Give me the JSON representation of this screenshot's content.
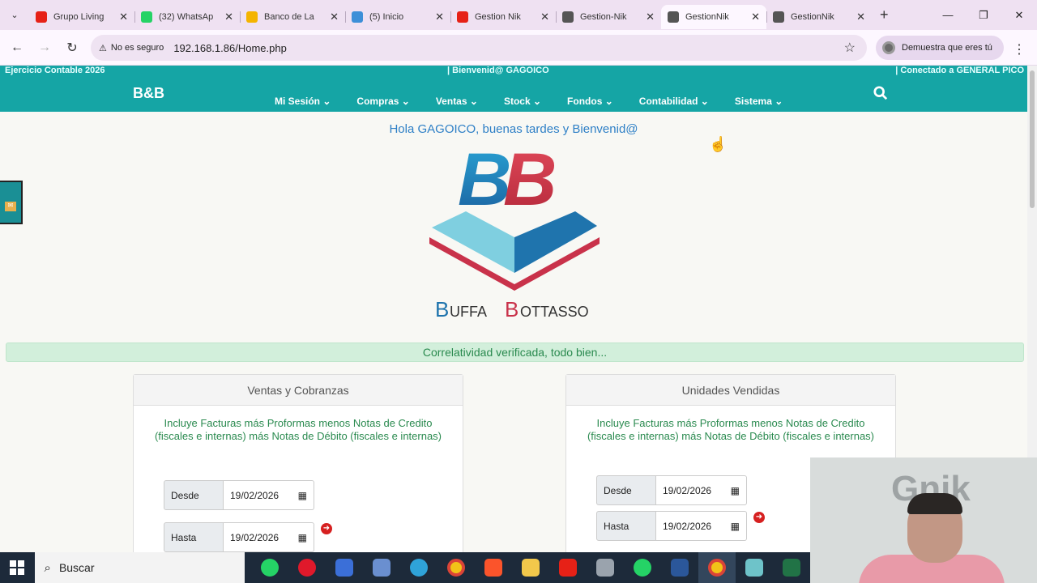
{
  "tabs": [
    {
      "label": "Grupo Living",
      "icon": "youtube-icon",
      "color": "#e62117"
    },
    {
      "label": "(32) WhatsAp",
      "icon": "whatsapp-icon",
      "color": "#25d366"
    },
    {
      "label": "Banco de La",
      "icon": "bank-icon",
      "color": "#f4b400"
    },
    {
      "label": "(5) Inicio",
      "icon": "cloud-icon",
      "color": "#3d8fd8"
    },
    {
      "label": "Gestion Nik",
      "icon": "youtube-icon",
      "color": "#e62117"
    },
    {
      "label": "Gestion-Nik",
      "icon": "network-icon",
      "color": "#555555"
    },
    {
      "label": "GestionNik",
      "icon": "globe-icon",
      "color": "#555555",
      "active": true
    },
    {
      "label": "GestionNik",
      "icon": "globe-icon",
      "color": "#555555"
    }
  ],
  "address": {
    "security": "No es seguro",
    "url": "192.168.1.86/Home.php"
  },
  "profile": {
    "label": "Demuestra que eres tú"
  },
  "site": {
    "ejercicio": "Ejercicio Contable 2026",
    "bienvenida_top": "| Bienvenid@ GAGOICO",
    "conectado": "| Conectado a GENERAL PICO",
    "brand": "B&B",
    "menu": [
      "Mi Sesión",
      "Compras",
      "Ventas",
      "Stock",
      "Fondos",
      "Contabilidad",
      "Sistema"
    ],
    "hello": "Hola GAGOICO, buenas tardes y Bienvenid@",
    "logo_text_b1": "B",
    "logo_text_rest1": "UFFA",
    "logo_text_b2": "B",
    "logo_text_rest2": "OTTASSO",
    "verify": "Correlatividad verificada, todo bien..."
  },
  "cards": [
    {
      "title": "Ventas y Cobranzas",
      "desc": "Incluye Facturas más Proformas menos Notas de Credito (fiscales e internas) más Notas de Débito (fiscales e internas)",
      "desde_label": "Desde",
      "desde": "19/02/2026",
      "hasta_label": "Hasta",
      "hasta": "19/02/2026"
    },
    {
      "title": "Unidades Vendidas",
      "desc": "Incluye Facturas más Proformas menos Notas de Credito (fiscales e internas) más Notas de Débito (fiscales e internas)",
      "desde_label": "Desde",
      "desde": "19/02/2026",
      "hasta_label": "Hasta",
      "hasta": "19/02/2026"
    }
  ],
  "webcam": {
    "overlay_text": "Gnik"
  },
  "taskbar": {
    "search": "Buscar"
  },
  "colors": {
    "teal": "#15a5a5",
    "accent_red": "#d62020",
    "success": "#2a8a4f"
  }
}
